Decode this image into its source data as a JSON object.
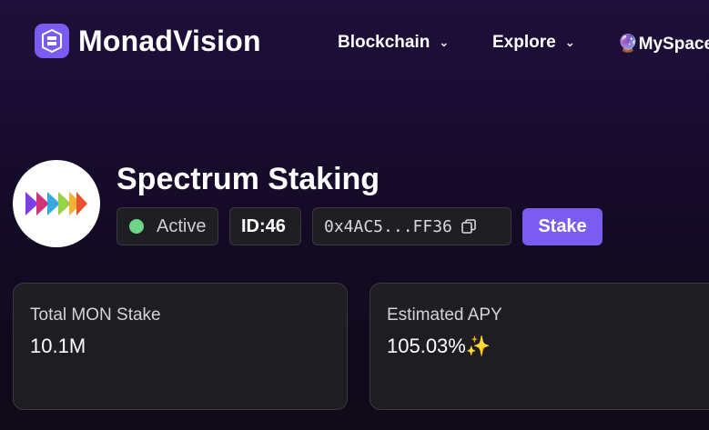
{
  "header": {
    "brand": "MonadVision",
    "nav": [
      {
        "label": "Blockchain",
        "icon": "chevron-down-icon"
      },
      {
        "label": "Explore",
        "icon": "chevron-down-icon"
      },
      {
        "label": "🔮MySpace"
      }
    ]
  },
  "validator": {
    "name": "Spectrum Staking",
    "status": "Active",
    "status_color": "#6dd48a",
    "id_prefix": "ID:",
    "id_value": "46",
    "address": "0x4AC5...FF36",
    "stake_label": "Stake"
  },
  "stats": [
    {
      "label": "Total MON Stake",
      "value": "10.1M"
    },
    {
      "label": "Estimated APY",
      "value": "105.03%✨"
    }
  ],
  "colors": {
    "accent": "#7b5cf0"
  }
}
